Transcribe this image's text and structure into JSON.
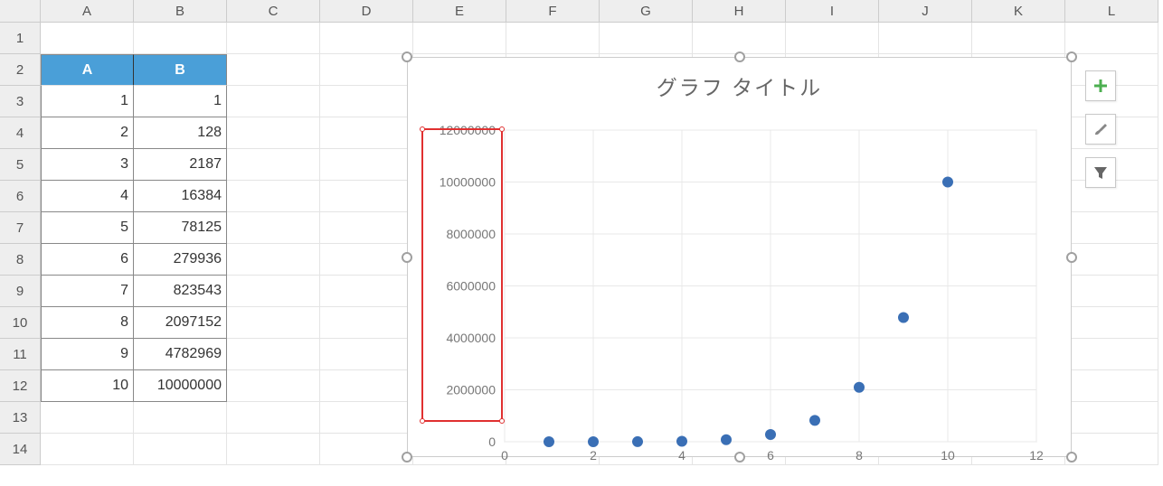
{
  "columns": [
    "A",
    "B",
    "C",
    "D",
    "E",
    "F",
    "G",
    "H",
    "I",
    "J",
    "K",
    "L"
  ],
  "rows": [
    "1",
    "2",
    "3",
    "4",
    "5",
    "6",
    "7",
    "8",
    "9",
    "10",
    "11",
    "12",
    "13",
    "14"
  ],
  "table": {
    "headers": [
      "A",
      "B"
    ],
    "data": [
      {
        "a": "1",
        "b": "1"
      },
      {
        "a": "2",
        "b": "128"
      },
      {
        "a": "3",
        "b": "2187"
      },
      {
        "a": "4",
        "b": "16384"
      },
      {
        "a": "5",
        "b": "78125"
      },
      {
        "a": "6",
        "b": "279936"
      },
      {
        "a": "7",
        "b": "823543"
      },
      {
        "a": "8",
        "b": "2097152"
      },
      {
        "a": "9",
        "b": "4782969"
      },
      {
        "a": "10",
        "b": "10000000"
      }
    ]
  },
  "chart": {
    "title": "グラフ タイトル",
    "x_ticks": [
      "0",
      "2",
      "4",
      "6",
      "8",
      "10",
      "12"
    ],
    "y_ticks": [
      "0",
      "2000000",
      "4000000",
      "6000000",
      "8000000",
      "10000000",
      "12000000"
    ]
  },
  "side_buttons": {
    "add": "plus-icon",
    "style": "brush-icon",
    "filter": "funnel-icon"
  },
  "chart_data": {
    "type": "scatter",
    "title": "グラフ タイトル",
    "xlabel": "",
    "ylabel": "",
    "xlim": [
      0,
      12
    ],
    "ylim": [
      0,
      12000000
    ],
    "x_ticks": [
      0,
      2,
      4,
      6,
      8,
      10,
      12
    ],
    "y_ticks": [
      0,
      2000000,
      4000000,
      6000000,
      8000000,
      10000000,
      12000000
    ],
    "series": [
      {
        "name": "B",
        "x": [
          1,
          2,
          3,
          4,
          5,
          6,
          7,
          8,
          9,
          10
        ],
        "y": [
          1,
          128,
          2187,
          16384,
          78125,
          279936,
          823543,
          2097152,
          4782969,
          10000000
        ]
      }
    ]
  }
}
